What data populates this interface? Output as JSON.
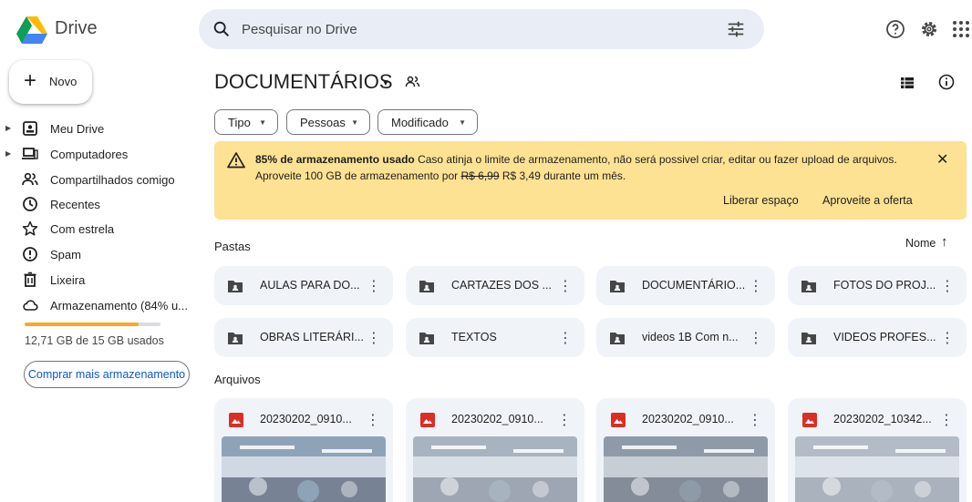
{
  "header": {
    "app_name": "Drive",
    "search_placeholder": "Pesquisar no Drive",
    "icons": [
      "help-icon",
      "settings-icon",
      "apps-icon"
    ]
  },
  "sidebar": {
    "new_label": "Novo",
    "items": [
      {
        "label": "Meu Drive",
        "icon": "my-drive-icon"
      },
      {
        "label": "Computadores",
        "icon": "computer-icon"
      },
      {
        "label": "Compartilhados comigo",
        "icon": "shared-with-me-icon"
      },
      {
        "label": "Recentes",
        "icon": "clock-icon"
      },
      {
        "label": "Com estrela",
        "icon": "star-icon"
      },
      {
        "label": "Spam",
        "icon": "spam-icon"
      },
      {
        "label": "Lixeira",
        "icon": "trash-icon"
      },
      {
        "label": "Armazenamento (84% u...",
        "icon": "cloud-icon"
      }
    ],
    "storage_fraction": 0.84,
    "storage_text": "12,71 GB de 15 GB usados",
    "buy_label": "Comprar mais armazenamento"
  },
  "main": {
    "title": "DOCUMENTÁRIOS",
    "filters": [
      "Tipo",
      "Pessoas",
      "Modificado"
    ],
    "banner": {
      "bold": "85% de armazenamento usado",
      "text": " Caso atinja o limite de armazenamento, não será possivel criar, editar ou fazer upload de arquivos.",
      "offer_pre": "Aproveite 100 GB de armazenamento por ",
      "old_price": "R$ 6,99",
      "offer_post": " R$ 3,49 durante um mês.",
      "action_free": "Liberar espaço",
      "action_offer": "Aproveite a oferta"
    },
    "folders_label": "Pastas",
    "sort_label": "Nome",
    "folders": [
      "AULAS PARA DO...",
      "CARTAZES DOS ...",
      "DOCUMENTÁRIO...",
      "FOTOS DO PROJ...",
      "OBRAS LITERÁRI...",
      "TEXTOS",
      "videos 1B Com n...",
      "VIDEOS PROFES..."
    ],
    "files_label": "Arquivos",
    "files": [
      "20230202_0910...",
      "20230202_0910...",
      "20230202_0910...",
      "20230202_10342..."
    ]
  },
  "colors": {
    "accent": "#0b57d0",
    "banner_bg": "#fde293",
    "storage_fill": "#f9a825",
    "folder_bg": "#f0f4f9",
    "image_icon": "#d93025"
  }
}
